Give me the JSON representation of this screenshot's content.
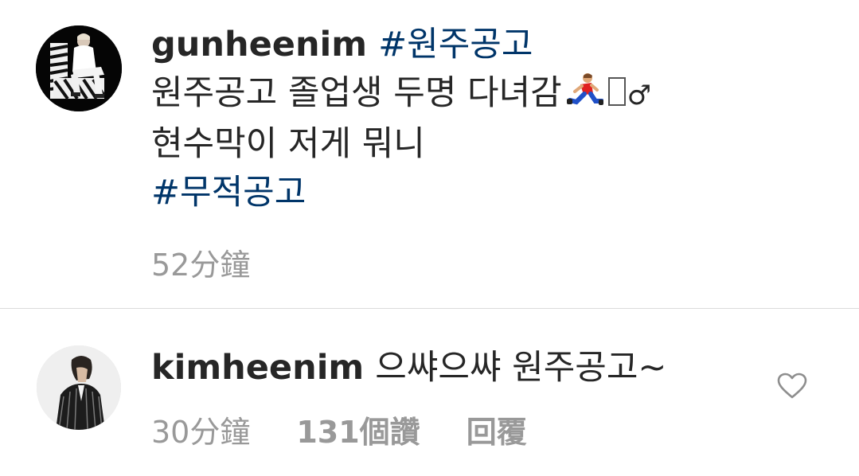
{
  "caption": {
    "username": "gunheenim",
    "hashtag_1": "#원주공고",
    "line_2_text": "원주공고 졸업생 두명 다녀감",
    "line_2_gender_symbol": "♂",
    "line_3_text": "현수막이 저게 뭐니",
    "hashtag_2": "#무적공고",
    "time_ago": "52分鐘",
    "emoji": "running-man-icon",
    "hashtag_color": "#003569"
  },
  "reply": {
    "username": "kimheenim",
    "text": "으쌰으쌰 원주공고~",
    "time_ago": "30分鐘",
    "likes": "131個讚",
    "reply_action": "回覆",
    "like_icon": "heart-outline-icon"
  },
  "colors": {
    "text": "#262626",
    "secondary": "#999999",
    "divider": "#dbdbdb"
  }
}
